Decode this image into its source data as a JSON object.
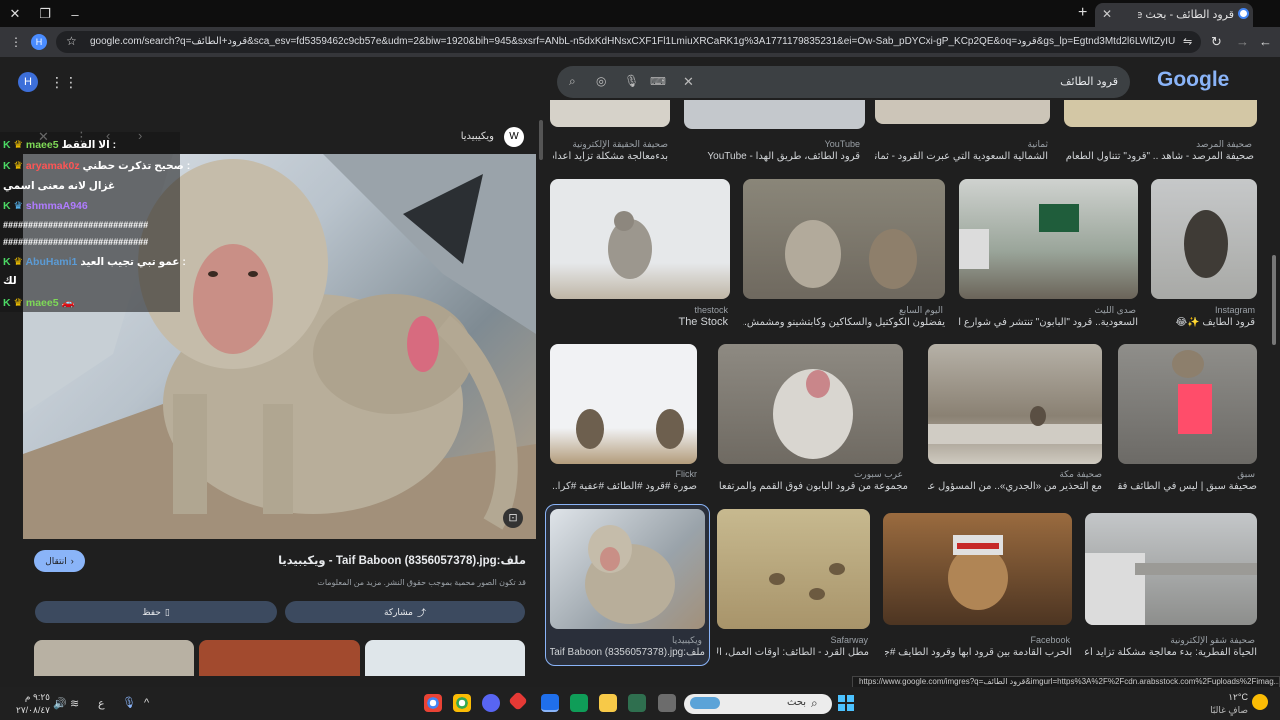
{
  "browser": {
    "tab_title": "قرود الطائف - بحث Google",
    "url": "google.com/search?q=قرود+الطائف&sca_esv=fd5359462c9cb57e&udm=2&biw=1920&bih=945&sxsrf=ANbL-n5dxKdHNsxCXF1Fl1LmiuXRCaRK1g%3A1771179835231&ei=Ow-Sab_pDYCxi-gP_KCp2QE&oq=قرود&gs_lp=Egtnd3Mtd2l6LWltZyIU2YLYsdmI2K8gKgll..."
  },
  "google": {
    "logo_text": "Google",
    "search_query": "قرود الطائف"
  },
  "side_panel": {
    "source": "ويكيبيديا",
    "source_badge": "W",
    "title": "ملف:Taif Baboon (8356057378).jpg - ويكيبيديا",
    "license_note": "قد تكون الصور محمية بموجب حقوق النشر. مزيد من المعلومات",
    "visit_label": "انتقال",
    "share_label": "مشاركة",
    "save_label": "حفظ"
  },
  "chat_overlay": {
    "header": "الا الفقط :",
    "lines": [
      {
        "user": "maee5",
        "msg": "",
        "color": "#7ed957"
      },
      {
        "user": "aryamak0z",
        "msg": "صحيح تذكرت حطني :",
        "color": "#ff5555"
      },
      {
        "user": "",
        "msg": "غزال لانه معنى اسمي",
        "color": "#ffffff"
      },
      {
        "user": "shmmaA946",
        "msg": "",
        "color": "#b07cff"
      },
      {
        "user": "",
        "msg": "#############################",
        "color": "#ffffff"
      },
      {
        "user": "AbuHami1",
        "msg": "عمو تبي تجيب العيد :",
        "color": "#5b9bd5"
      },
      {
        "user": "",
        "msg": "لك",
        "color": "#ffffff"
      },
      {
        "user": "maee5",
        "msg": "",
        "color": "#7ed957"
      }
    ]
  },
  "row0": [
    {
      "source": "صحيفة المرصد",
      "caption": "صحيفة المرصد - شاهد .. \"قرود\" تتناول الطعام عا..."
    },
    {
      "source": "ثمانية",
      "caption": "الشمالية السعودية التي عبرت القرود - ثمانية"
    },
    {
      "source": "YouTube",
      "caption": "قرود الطائف، طريق الهدا - YouTube"
    },
    {
      "source": "صحيفة الحقيقة الإلكترونية",
      "caption": "بدءمعالجة مشكلة تزايد أعداد ق..."
    }
  ],
  "row1": [
    {
      "source": "Instagram",
      "caption": "قرود الطايف ✨😂"
    },
    {
      "source": "صدى الليث",
      "caption": "السعودية.. قرود \"البابون\" تنتشر في شوارع الط..."
    },
    {
      "source": "اليوم السابع",
      "caption": "يفضلون الكوكتيل والسكاكين وكابتشينو ومشمش.. قرد البا..."
    },
    {
      "source": "thestock",
      "caption": "The Stock"
    }
  ],
  "row2": [
    {
      "source": "سبق",
      "caption": "صحيفة سبق | ليس في الطائف فقط..."
    },
    {
      "source": "صحيفة مكة",
      "caption": "مع التحذير من «الجدري».. من المسؤول عن م..."
    },
    {
      "source": "عرب سبورت",
      "caption": "مجموعة من قرود البابون فوق القمم والمرتفعات الجبلية"
    },
    {
      "source": "Flickr",
      "caption": "صورة #قرود #الطائف #عفية #كرا..."
    }
  ],
  "row3": [
    {
      "source": "صحيفة شقو الإلكترونية",
      "caption": "الحياة الفطرية: بدء معالجة مشكلة تزايد أعداد..."
    },
    {
      "source": "Facebook",
      "caption": "الحرب القادمة بين قرود ابها وقرود الطايف #جر..."
    },
    {
      "source": "Safarway",
      "caption": "مطل القرد - الطائف: أوقات العمل، الأد..."
    },
    {
      "source": "ويكيبيديا",
      "caption": "ملف:Taif Baboon (8356057378).jpg..."
    }
  ],
  "status_url": "https://www.google.com/imgres?q=قرود الطائف&imgurl=https%3A%2F%2Fcdn.arabsstock.com%2Fuploads%2Fimag...",
  "taskbar": {
    "search_placeholder": "بحث",
    "weather_temp": "١٢°C",
    "weather_desc": "صافٍ غالبًا",
    "time": "٩:٢٥ م",
    "date": "٢٧/٠٨/٤٧",
    "lang": "ع"
  }
}
